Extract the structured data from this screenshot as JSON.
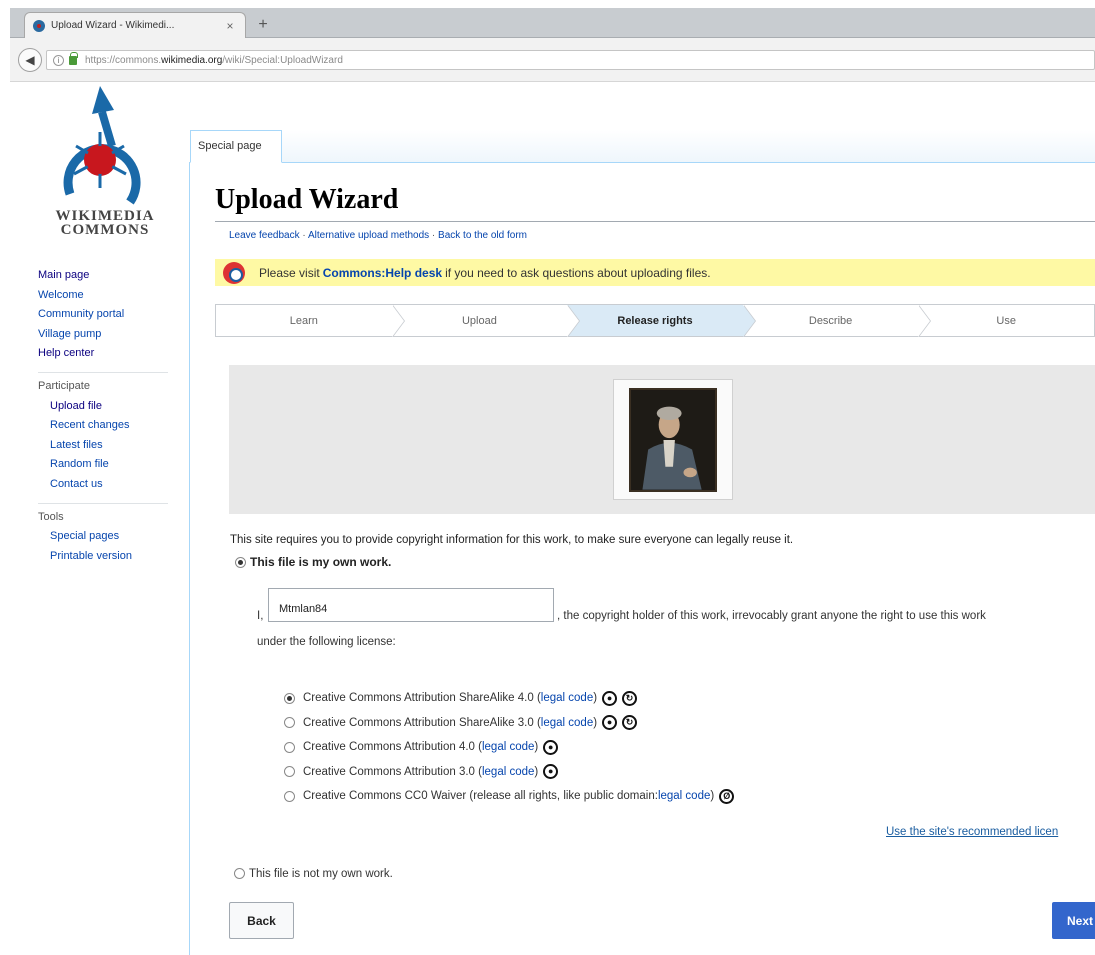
{
  "browser": {
    "tab_title": "Upload Wizard - Wikimedi...",
    "tab_close": "×",
    "new_tab": "+",
    "url_prefix": "https://commons.",
    "url_host": "wikimedia.org",
    "url_path": "/wiki/Special:UploadWizard"
  },
  "logo": {
    "line1": "WIKIMEDIA",
    "line2": "COMMONS"
  },
  "sidebar": {
    "main_links": [
      "Main page",
      "Welcome",
      "Community portal",
      "Village pump",
      "Help center"
    ],
    "participate_heading": "Participate",
    "participate_links": [
      "Upload file",
      "Recent changes",
      "Latest files",
      "Random file",
      "Contact us"
    ],
    "tools_heading": "Tools",
    "tools_links": [
      "Special pages",
      "Printable version"
    ]
  },
  "content": {
    "special_tab": "Special page",
    "title": "Upload Wizard",
    "sublinks": {
      "feedback": "Leave feedback",
      "sep1": " · ",
      "alternative": "Alternative upload methods",
      "sep2": " · ",
      "old_form": "Back to the old form"
    },
    "notice": {
      "before": "Please visit",
      "link": "Commons:Help desk",
      "after": "if you need to ask questions about uploading files."
    },
    "steps": [
      "Learn",
      "Upload",
      "Release rights",
      "Describe",
      "Use"
    ],
    "active_step": "Release rights",
    "copyright_intro": "This site requires you to provide copyright information for this work, to make sure everyone can legally reuse it.",
    "own_work_label": "This file is my own work.",
    "i_label": "I,",
    "username": "Mtmlan84",
    "grant_text": ", the copyright holder of this work, irrevocably grant anyone the right to use this work",
    "grant_text2": "under the following license:",
    "licenses": [
      {
        "label": "Creative Commons Attribution ShareAlike 4.0 (",
        "link": "legal code",
        "close": ")",
        "icons": [
          "BY",
          "SA"
        ],
        "selected": true
      },
      {
        "label": "Creative Commons Attribution ShareAlike 3.0 (",
        "link": "legal code",
        "close": ")",
        "icons": [
          "BY",
          "SA"
        ],
        "selected": false
      },
      {
        "label": "Creative Commons Attribution 4.0 (",
        "link": "legal code",
        "close": ")",
        "icons": [
          "BY"
        ],
        "selected": false
      },
      {
        "label": "Creative Commons Attribution 3.0 (",
        "link": "legal code",
        "close": ")",
        "icons": [
          "BY"
        ],
        "selected": false
      },
      {
        "label": "Creative Commons CC0 Waiver (release all rights, like public domain: ",
        "link": "legal code",
        "close": ")",
        "icons": [
          "0"
        ],
        "selected": false
      }
    ],
    "recommended_link": "Use the site's recommended licen",
    "not_own_work_label": "This file is not my own work.",
    "back_button": "Back",
    "next_button": "Next"
  },
  "colors": {
    "link": "#0645ad",
    "notice_bg": "#fef9a4",
    "active_step_bg": "#daeaf6",
    "primary_button": "#3366cc"
  }
}
